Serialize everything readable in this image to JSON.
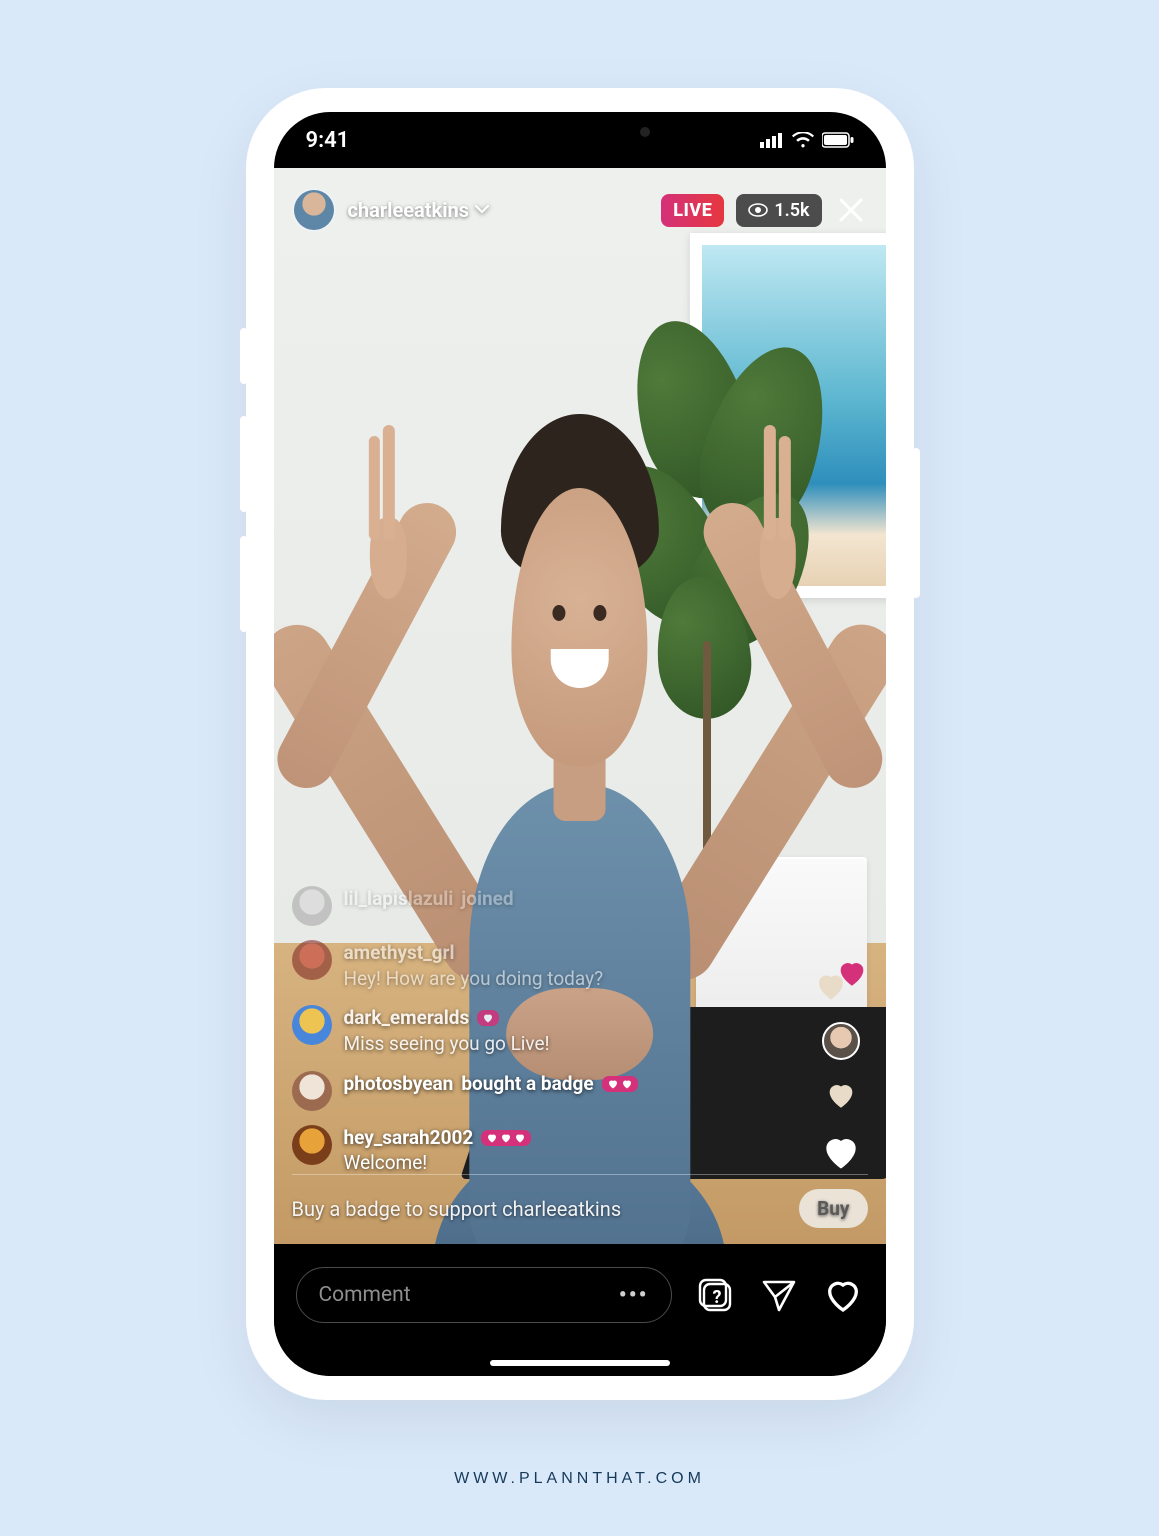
{
  "footer": {
    "site": "WWW.PLANNTHAT.COM"
  },
  "status": {
    "time": "9:41"
  },
  "live_header": {
    "username": "charleeatkins",
    "live_label": "LIVE",
    "viewer_count": "1.5k"
  },
  "comments": [
    {
      "user": "lil_lapislazuli",
      "suffix": "joined",
      "text": "",
      "hearts": 0,
      "opacity": "faded1"
    },
    {
      "user": "amethyst_grl",
      "suffix": "",
      "text": "Hey! How are you doing today?",
      "hearts": 0,
      "opacity": "faded2"
    },
    {
      "user": "dark_emeralds",
      "suffix": "",
      "text": "Miss seeing you go Live!",
      "hearts": 1,
      "opacity": "faded3"
    },
    {
      "user": "photosbyean",
      "suffix": "bought a badge",
      "text": "",
      "hearts": 2,
      "opacity": ""
    },
    {
      "user": "hey_sarah2002",
      "suffix": "",
      "text": "Welcome!",
      "hearts": 3,
      "opacity": ""
    }
  ],
  "support": {
    "text": "Buy a badge to support charleeatkins",
    "button": "Buy"
  },
  "bottom": {
    "comment_placeholder": "Comment"
  },
  "colors": {
    "live_gradient_from": "#d4317a",
    "live_gradient_to": "#e6373f",
    "page_bg": "#dae9fa"
  }
}
